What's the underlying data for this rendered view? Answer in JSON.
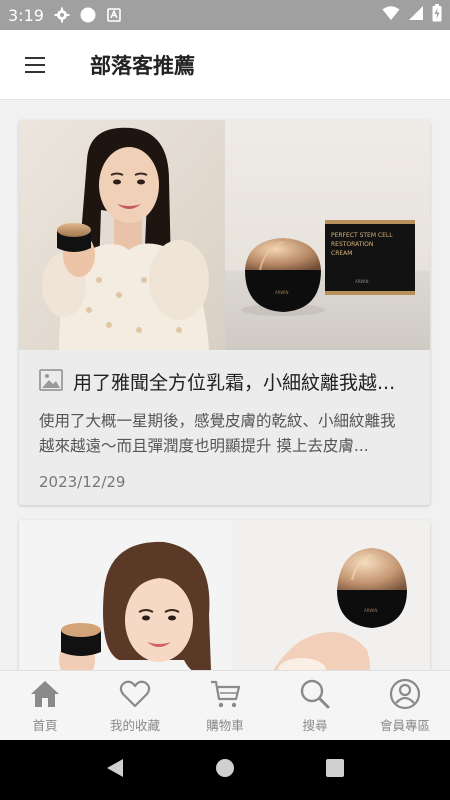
{
  "status_bar": {
    "time": "3:19",
    "colors": {
      "background": "#a0a0a0"
    }
  },
  "app_bar": {
    "title": "部落客推薦",
    "menu_icon": "hamburger-menu-icon"
  },
  "cards": [
    {
      "title": "用了雅聞全方位乳霜，小細紋離我越...",
      "description": "使用了大概一星期後，感覺皮膚的乾紋、小細紋離我越來越遠～而且彈潤度也明顯提升 摸上去皮膚...",
      "date": "2023/12/29",
      "product_box_text": "PERFECT STEM CELL RESTORATION CREAM",
      "brand": "ARWIN"
    },
    {
      "product_jar_brand": "ARWIN"
    }
  ],
  "bottom_nav": [
    {
      "label": "首頁",
      "icon": "home-icon"
    },
    {
      "label": "我的收藏",
      "icon": "heart-icon"
    },
    {
      "label": "購物車",
      "icon": "cart-icon"
    },
    {
      "label": "搜尋",
      "icon": "search-icon"
    },
    {
      "label": "會員專區",
      "icon": "user-icon"
    }
  ],
  "colors": {
    "nav_icon": "#8a8a8a",
    "card_bg": "#ececec",
    "page_bg": "#f1f1f1"
  }
}
